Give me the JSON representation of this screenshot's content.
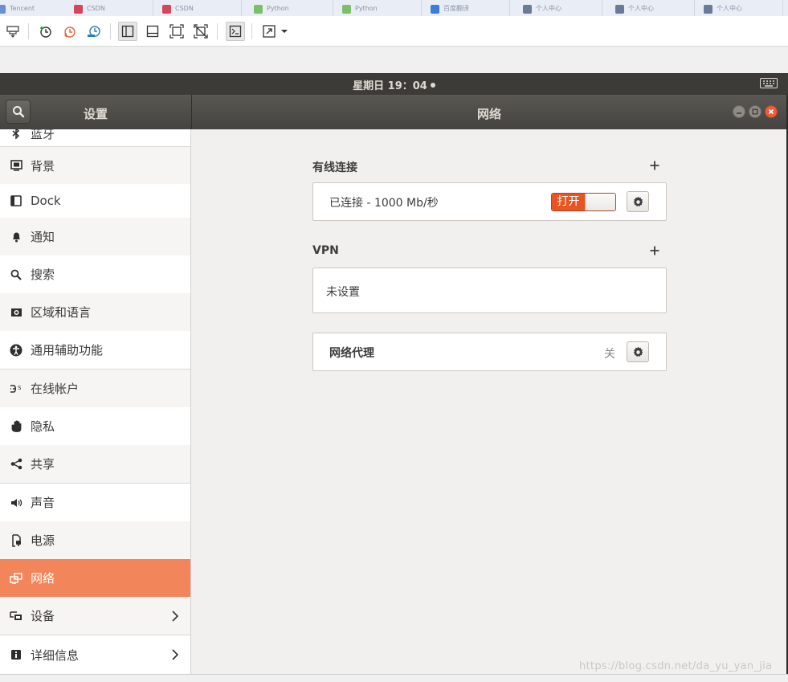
{
  "host": {
    "tabs": [
      {
        "label": "Tencent",
        "color": "#6b8fd6"
      },
      {
        "label": "CSDN",
        "color": "#d6455a"
      },
      {
        "label": "CSDN",
        "color": "#d6455a"
      },
      {
        "label": "Python",
        "color": "#7bbf6a"
      },
      {
        "label": "Python",
        "color": "#7bbf6a"
      },
      {
        "label": "百度翻译",
        "color": "#3b7ddd"
      },
      {
        "label": "个人中心",
        "color": "#6b7a99"
      },
      {
        "label": "个人中心",
        "color": "#6b7a99"
      },
      {
        "label": "个人中心",
        "color": "#6b7a99"
      }
    ]
  },
  "vm_toolbar": {
    "icons": [
      "send-ctrl-alt-del-icon",
      "snapshot-take-icon",
      "snapshot-revert-icon",
      "snapshot-manager-icon",
      "sidebar-view-icon",
      "thumbnail-view-icon",
      "fullscreen-icon",
      "unity-mode-icon",
      "console-view-icon",
      "stretch-view-icon"
    ]
  },
  "top_panel": {
    "clock": "星期日 19：04"
  },
  "window": {
    "sidebar_title": "设置",
    "page_title": "网络"
  },
  "sidebar": {
    "partial_item": "蓝牙",
    "items": [
      {
        "label": "背景",
        "icon": "background-icon"
      },
      {
        "label": "Dock",
        "icon": "dock-icon"
      },
      {
        "label": "通知",
        "icon": "bell-icon"
      },
      {
        "label": "搜索",
        "icon": "search-icon"
      },
      {
        "label": "区域和语言",
        "icon": "flag-icon"
      },
      {
        "label": "通用辅助功能",
        "icon": "accessibility-icon"
      },
      {
        "label": "在线帐户",
        "icon": "online-accounts-icon"
      },
      {
        "label": "隐私",
        "icon": "hand-icon"
      },
      {
        "label": "共享",
        "icon": "share-icon"
      },
      {
        "label": "声音",
        "icon": "speaker-icon"
      },
      {
        "label": "电源",
        "icon": "power-icon"
      },
      {
        "label": "网络",
        "icon": "network-icon"
      },
      {
        "label": "设备",
        "icon": "devices-icon"
      },
      {
        "label": "详细信息",
        "icon": "info-icon"
      }
    ]
  },
  "network": {
    "wired": {
      "title": "有线连接",
      "status": "已连接 - 1000 Mb/秒",
      "switch_label": "打开",
      "switch_on": true
    },
    "vpn": {
      "title": "VPN",
      "empty_text": "未设置"
    },
    "proxy": {
      "label": "网络代理",
      "state": "关"
    }
  },
  "watermark": "https://blog.csdn.net/da_yu_yan_jia",
  "colors": {
    "accent": "#e95420",
    "selected_row": "#f3855a",
    "panel": "#3c3b37"
  }
}
